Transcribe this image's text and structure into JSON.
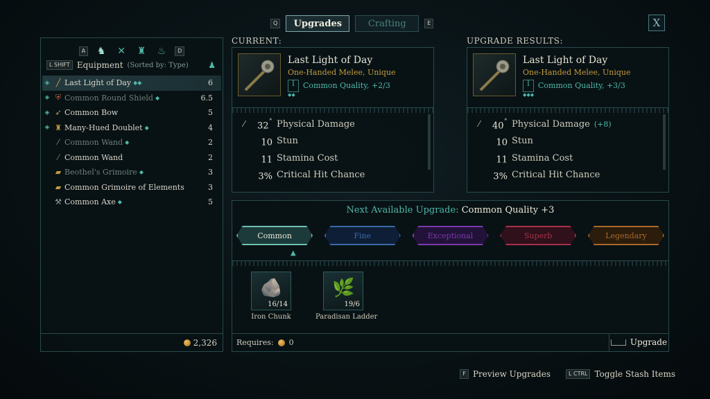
{
  "top_tabs": {
    "left_key": "Q",
    "right_key": "E",
    "tabs": [
      {
        "label": "Upgrades",
        "active": true
      },
      {
        "label": "Crafting",
        "active": false
      }
    ],
    "close_label": "X"
  },
  "left_panel": {
    "filter_left_key": "A",
    "filter_right_key": "D",
    "filter_icons": [
      "all-gear-icon",
      "crossed-swords-icon",
      "armor-icon",
      "lamp-icon"
    ],
    "header_key": "L SHIFT",
    "title": "Equipment",
    "sort": "(Sorted by: Type)",
    "items": [
      {
        "name": "Last Light of Day",
        "level": "6",
        "selected": true,
        "dim": false,
        "pips": "◆◆",
        "icon": "sword-icon"
      },
      {
        "name": "Common Round Shield",
        "level": "6.5",
        "selected": false,
        "dim": true,
        "pips": "◆",
        "icon": "shield-icon"
      },
      {
        "name": "Common Bow",
        "level": "5",
        "selected": false,
        "dim": false,
        "pips": "",
        "icon": "bow-icon"
      },
      {
        "name": "Many-Hued Doublet",
        "level": "4",
        "selected": false,
        "dim": false,
        "pips": "◆",
        "icon": "armor-icon"
      },
      {
        "name": "Common Wand",
        "level": "2",
        "selected": false,
        "dim": true,
        "pips": "◆",
        "icon": "wand-icon"
      },
      {
        "name": "Common Wand",
        "level": "2",
        "selected": false,
        "dim": false,
        "pips": "",
        "icon": "wand-icon"
      },
      {
        "name": "Beothel's Grimoire",
        "level": "3",
        "selected": false,
        "dim": true,
        "pips": "◆",
        "icon": "book-icon"
      },
      {
        "name": "Common Grimoire of Elements",
        "level": "3",
        "selected": false,
        "dim": false,
        "pips": "",
        "icon": "book-icon"
      },
      {
        "name": "Common Axe",
        "level": "5",
        "selected": false,
        "dim": false,
        "pips": "◆",
        "icon": "axe-icon"
      }
    ],
    "gold": "2,326"
  },
  "current": {
    "section_label": "CURRENT:",
    "name": "Last Light of Day",
    "type": "One-Handed Melee, Unique",
    "quality_level": "I",
    "quality_text": "Common Quality, +2/3",
    "stats": [
      {
        "value": "32",
        "name": "Physical Damage",
        "delta": "",
        "arrow": "˄"
      },
      {
        "value": "10",
        "name": "Stun",
        "delta": "",
        "arrow": ""
      },
      {
        "value": "11",
        "name": "Stamina Cost",
        "delta": "",
        "arrow": ""
      },
      {
        "value": "3%",
        "name": "Critical Hit Chance",
        "delta": "",
        "arrow": ""
      }
    ]
  },
  "result": {
    "section_label": "UPGRADE RESULTS:",
    "name": "Last Light of Day",
    "type": "One-Handed Melee, Unique",
    "quality_level": "I",
    "quality_text": "Common Quality, +3/3",
    "stats": [
      {
        "value": "40",
        "name": "Physical Damage",
        "delta": "(+8)",
        "arrow": "˄"
      },
      {
        "value": "10",
        "name": "Stun",
        "delta": "",
        "arrow": ""
      },
      {
        "value": "11",
        "name": "Stamina Cost",
        "delta": "",
        "arrow": ""
      },
      {
        "value": "3%",
        "name": "Critical Hit Chance",
        "delta": "",
        "arrow": ""
      }
    ]
  },
  "upgrade": {
    "next_label": "Next Available Upgrade:",
    "next_value": "Common Quality +3",
    "tiers": [
      {
        "label": "Common",
        "color": "#6ec0b0",
        "fill": "#1c3a3a",
        "active": true
      },
      {
        "label": "Fine",
        "color": "#3a6aa8",
        "fill": "#0e1e36",
        "active": false
      },
      {
        "label": "Exceptional",
        "color": "#7a3aa8",
        "fill": "#22123a",
        "active": false
      },
      {
        "label": "Superb",
        "color": "#a8304a",
        "fill": "#30101a",
        "active": false
      },
      {
        "label": "Legendary",
        "color": "#a86a2a",
        "fill": "#2c1c0c",
        "active": false
      }
    ],
    "materials": [
      {
        "name": "Iron Chunk",
        "count": "16/14",
        "art": "🪨"
      },
      {
        "name": "Paradisan Ladder",
        "count": "19/6",
        "art": "🌿"
      }
    ],
    "requires_label": "Requires:",
    "requires_value": "0",
    "upgrade_label": "Upgrade"
  },
  "hints": [
    {
      "key": "F",
      "label": "Preview Upgrades"
    },
    {
      "key": "L CTRL",
      "label": "Toggle Stash Items"
    }
  ]
}
